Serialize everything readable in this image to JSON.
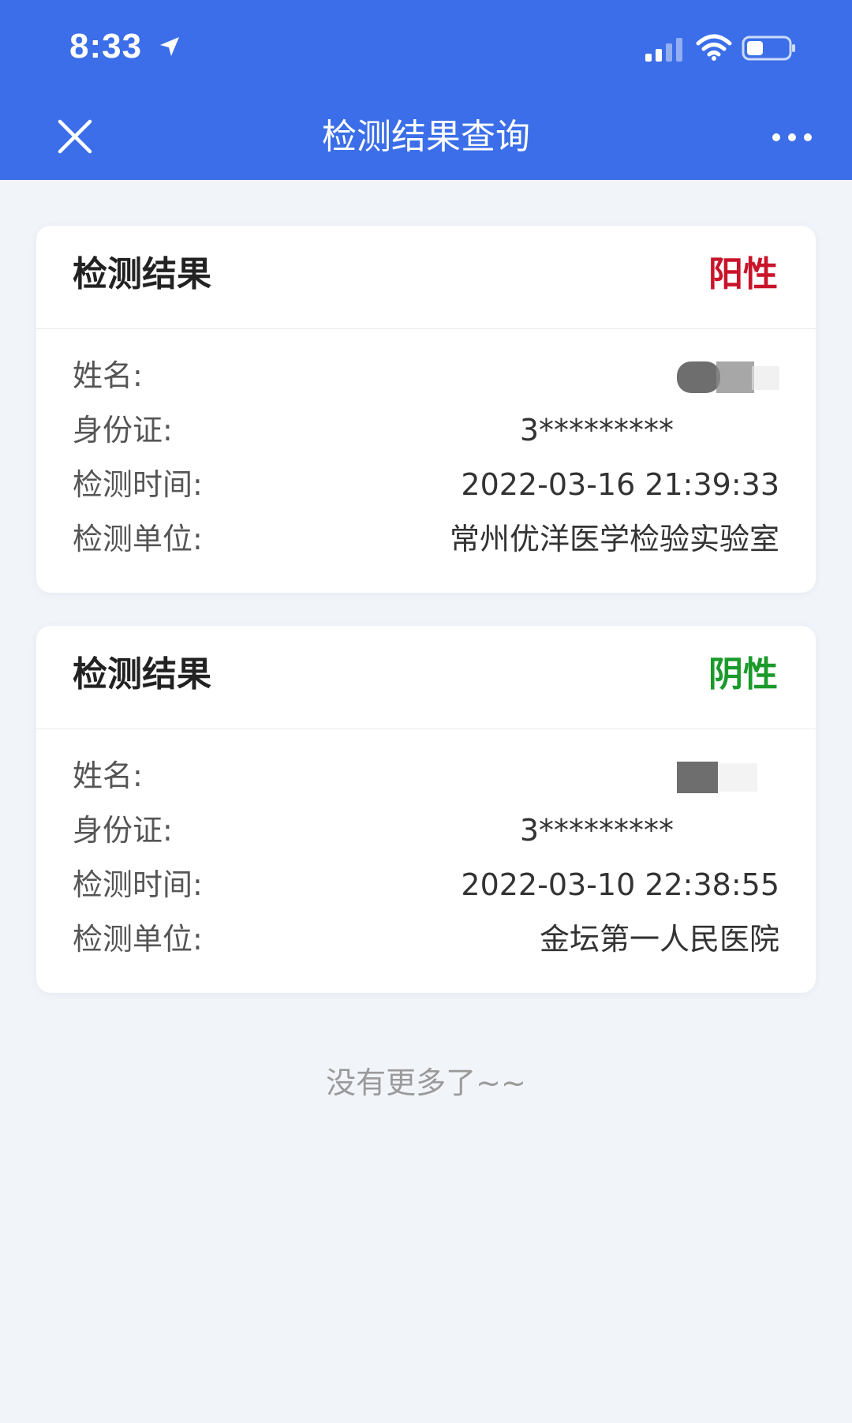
{
  "status_bar": {
    "time": "8:33",
    "icons": [
      "location-arrow-icon",
      "cellular-signal-icon",
      "wifi-icon",
      "battery-icon"
    ]
  },
  "nav": {
    "title": "检测结果查询",
    "close_icon": "close-icon",
    "more_icon": "more-icon"
  },
  "results": [
    {
      "title": "检测结果",
      "result": "阳性",
      "result_color": "#c8142a",
      "rows": [
        {
          "label": "姓名:",
          "value": ""
        },
        {
          "label": "身份证:",
          "value": "3*********"
        },
        {
          "label": "检测时间:",
          "value": "2022-03-16 21:39:33"
        },
        {
          "label": "检测单位:",
          "value": "常州优洋医学检验实验室"
        }
      ]
    },
    {
      "title": "检测结果",
      "result": "阴性",
      "result_color": "#1a9a2a",
      "rows": [
        {
          "label": "姓名:",
          "value": ""
        },
        {
          "label": "身份证:",
          "value": "3*********"
        },
        {
          "label": "检测时间:",
          "value": "2022-03-10 22:38:55"
        },
        {
          "label": "检测单位:",
          "value": "金坛第一人民医院"
        }
      ]
    }
  ],
  "footer": {
    "text": "没有更多了~~"
  },
  "colors": {
    "header_bg": "#3b6ee8",
    "page_bg": "#f1f4f9"
  }
}
